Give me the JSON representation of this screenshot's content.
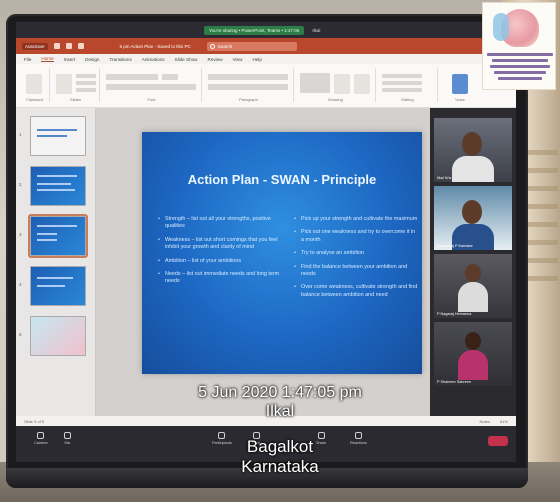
{
  "teams_bar": {
    "share_text": "You're sharing • PowerPoint, Teams • 1:47:05",
    "user": "Ilkal"
  },
  "ppt": {
    "autosave": "AutoSave",
    "doc_title": "5 pm Action Plan - Saved to this PC",
    "search": "Search",
    "user_name": "",
    "tabs": [
      "File",
      "Home",
      "Insert",
      "Design",
      "Transitions",
      "Animations",
      "Slide Show",
      "Review",
      "View",
      "Help"
    ],
    "ribbon_groups": [
      "Clipboard",
      "Slides",
      "Font",
      "Paragraph",
      "Drawing",
      "Editing",
      "Voice"
    ]
  },
  "slide": {
    "title": "Action Plan - SWAN - Principle",
    "left_bullets": [
      "Strength – list out all your strengths, positive qualities",
      "Weakness – list out short comings that you feel inhibit your growth and clarity of mind",
      "Ambition – list of your ambitions",
      "Needs – list out immediate needs and long term needs"
    ],
    "right_bullets": [
      "Pick up your strength and cultivate the maximum",
      "Pick out one weakness and try to overcome it in a month",
      "Try to analyse an ambition",
      "Find the balance between your ambition and needs",
      "Over come weakness, cultivate strength and find balance between ambition and need"
    ]
  },
  "participants": [
    {
      "name": "Ilkal Kris"
    },
    {
      "name": "Basavaraj P Kamatar"
    },
    {
      "name": "P Nagaraj Hemanna"
    },
    {
      "name": "P Shaheen Sabreen"
    }
  ],
  "status": {
    "slide_info": "Slide 3 of 5",
    "notes": "Notes",
    "zoom": "61%"
  },
  "controls": {
    "buttons": [
      "Camera",
      "Mic",
      "Participants",
      "Chat",
      "Share",
      "Reactions"
    ]
  },
  "overlay": {
    "datetime": "5 Jun 2020 1:47:05 pm",
    "city": "Ilkal",
    "district": "Bagalkot",
    "state": "Karnataka"
  }
}
